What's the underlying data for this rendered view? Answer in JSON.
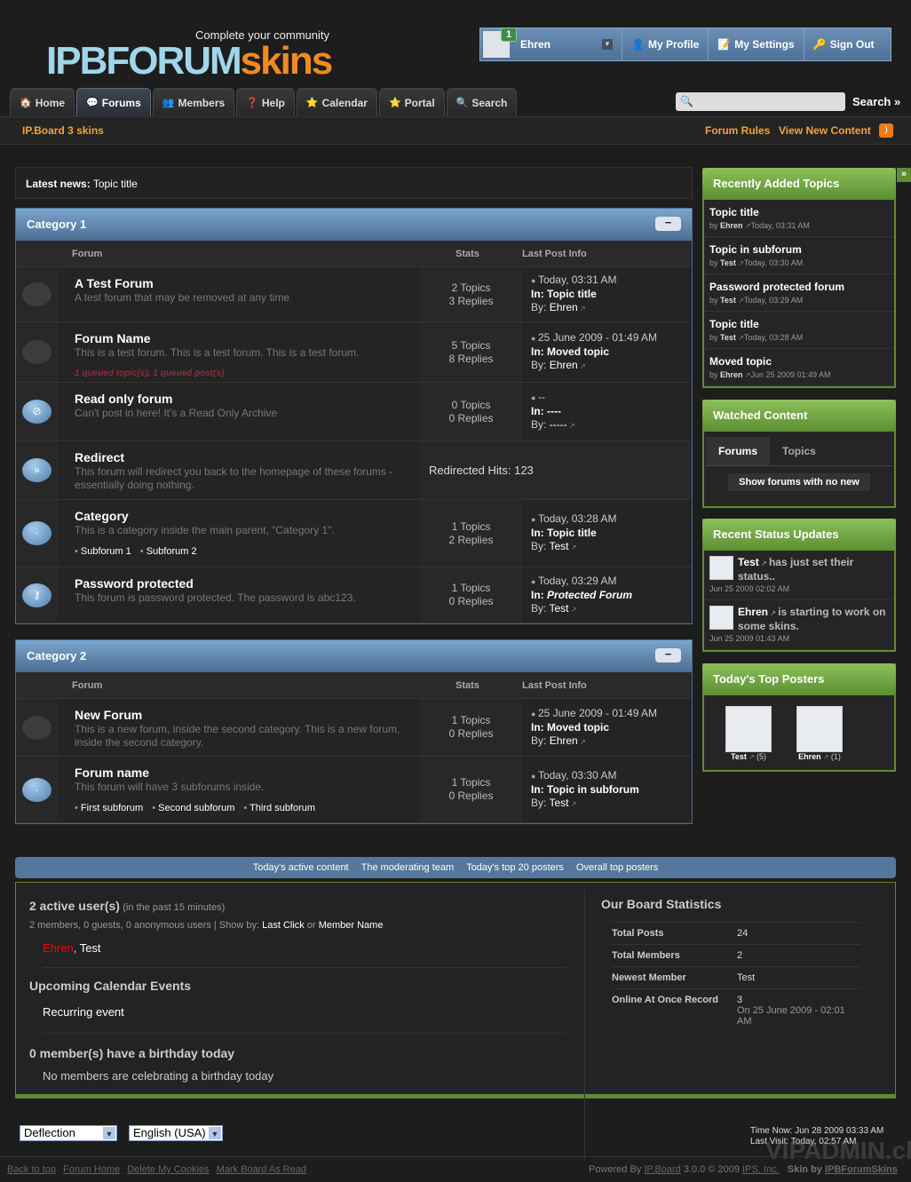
{
  "header": {
    "tagline": "Complete your community",
    "logo_a": "IPBFORUM",
    "logo_b": "SKINS",
    "user": {
      "name": "Ehren",
      "notifications": "1",
      "my_profile": "My Profile",
      "my_settings": "My Settings",
      "sign_out": "Sign Out"
    }
  },
  "nav": {
    "tabs": [
      "Home",
      "Forums",
      "Members",
      "Help",
      "Calendar",
      "Portal",
      "Search"
    ],
    "active": 1,
    "search_placeholder": "",
    "search_button": "Search »"
  },
  "subbar": {
    "board_name": "IP.Board 3 skins",
    "forum_rules": "Forum Rules",
    "view_new": "View New Content"
  },
  "news": {
    "label": "Latest news:",
    "value": "Topic title"
  },
  "columns": {
    "forum": "Forum",
    "stats": "Stats",
    "last": "Last Post Info"
  },
  "categories": [
    {
      "title": "Category 1",
      "collapse": "−",
      "forums": [
        {
          "icon": "no-new",
          "name": "A Test Forum",
          "desc": "A test forum that may be removed at any time",
          "topics": "2 Topics",
          "replies": "3 Replies",
          "date": "Today, 03:31 AM",
          "in_label": "In:",
          "in": "Topic title",
          "by_label": "By:",
          "by": "Ehren"
        },
        {
          "icon": "no-new",
          "name": "Forum Name",
          "desc": "This is a test forum. This is a test forum. This is a test forum.",
          "queued": "1 queued topic(s), 1 queued post(s)",
          "topics": "5 Topics",
          "replies": "8 Replies",
          "date": "25 June 2009 - 01:49 AM",
          "in_label": "In:",
          "in": "Moved topic",
          "by_label": "By:",
          "by": "Ehren"
        },
        {
          "icon": "read-only",
          "name": "Read only forum",
          "desc": "Can't post in here! It's a Read Only Archive",
          "topics": "0 Topics",
          "replies": "0 Replies",
          "date": "--",
          "in_label": "In:",
          "in": "----",
          "by_label": "By:",
          "by": "-----"
        },
        {
          "icon": "redirect",
          "name": "Redirect",
          "desc": "This forum will redirect you back to the homepage of these forums - essentially doing nothing.",
          "redirect": "Redirected Hits: 123"
        },
        {
          "icon": "category",
          "name": "Category",
          "desc": "This is a category inside the main parent, \"Category 1\".",
          "subforums": [
            "Subforum 1",
            "Subforum 2"
          ],
          "topics": "1 Topics",
          "replies": "2 Replies",
          "date": "Today, 03:28 AM",
          "in_label": "In:",
          "in": "Topic title",
          "by_label": "By:",
          "by": "Test"
        },
        {
          "icon": "password",
          "name": "Password protected",
          "desc": "This forum is password protected. The password is abc123.",
          "topics": "1 Topics",
          "replies": "0 Replies",
          "date": "Today, 03:29 AM",
          "in_label": "In:",
          "in": "Protected Forum",
          "in_italic": true,
          "by_label": "By:",
          "by": "Test"
        }
      ]
    },
    {
      "title": "Category 2",
      "collapse": "−",
      "forums": [
        {
          "icon": "no-new",
          "name": "New Forum",
          "desc": "This is a new forum, inside the second category. This is a new forum, inside the second category.",
          "topics": "1 Topics",
          "replies": "0 Replies",
          "date": "25 June 2009 - 01:49 AM",
          "in_label": "In:",
          "in": "Moved topic",
          "by_label": "By:",
          "by": "Ehren"
        },
        {
          "icon": "category",
          "name": "Forum name",
          "desc": "This forum will have 3 subforums inside.",
          "subforums": [
            "First subforum",
            "Second subforum",
            "Third subforum"
          ],
          "topics": "1 Topics",
          "replies": "0 Replies",
          "date": "Today, 03:30 AM",
          "in_label": "In:",
          "in": "Topic in subforum",
          "by_label": "By:",
          "by": "Test"
        }
      ]
    }
  ],
  "sidebar": {
    "recent_topics": {
      "title": "Recently Added Topics",
      "items": [
        {
          "title": "Topic title",
          "by": "by",
          "author": "Ehren",
          "date": "Today, 03:31 AM"
        },
        {
          "title": "Topic in subforum",
          "by": "by",
          "author": "Test",
          "date": "Today, 03:30 AM"
        },
        {
          "title": "Password protected forum",
          "by": "by",
          "author": "Test",
          "date": "Today, 03:29 AM"
        },
        {
          "title": "Topic title",
          "by": "by",
          "author": "Test",
          "date": "Today, 03:28 AM"
        },
        {
          "title": "Moved topic",
          "by": "by",
          "author": "Ehren",
          "date": "Jun 25 2009 01:49 AM"
        }
      ]
    },
    "watched": {
      "title": "Watched Content",
      "tabs": [
        "Forums",
        "Topics"
      ],
      "button": "Show forums with no new"
    },
    "status": {
      "title": "Recent Status Updates",
      "items": [
        {
          "name": "Test",
          "text": "has just set their status..",
          "date": "Jun 25 2009 02:02 AM"
        },
        {
          "name": "Ehren",
          "text": "is starting to work on some skins.",
          "date": "Jun 25 2009 01:43 AM"
        }
      ]
    },
    "top_posters": {
      "title": "Today's Top Posters",
      "items": [
        {
          "name": "Test",
          "count": "(5)"
        },
        {
          "name": "Ehren",
          "count": "(1)"
        }
      ]
    }
  },
  "statbar": [
    "Today's active content",
    "The moderating team",
    "Today's top 20 posters",
    "Overall top posters"
  ],
  "board": {
    "active_title": "2 active user(s)",
    "active_note": "(in the past 15 minutes)",
    "active_detail": "2 members, 0 guests, 0 anonymous users | Show by:",
    "last_click": "Last Click",
    "or": "or",
    "member_name": "Member Name",
    "users": [
      "Ehren",
      "Test"
    ],
    "calendar_title": "Upcoming Calendar Events",
    "calendar_event": "Recurring event",
    "birthday_title": "0 member(s) have a birthday today",
    "birthday_text": "No members are celebrating a birthday today",
    "stats_title": "Our Board Statistics",
    "stats": [
      {
        "k": "Total Posts",
        "v": "24"
      },
      {
        "k": "Total Members",
        "v": "2"
      },
      {
        "k": "Newest Member",
        "v": "Test"
      },
      {
        "k": "Online At Once Record",
        "v": "3",
        "sub": "On 25 June 2009 - 02:01 AM"
      }
    ]
  },
  "footer": {
    "skin": "Deflection",
    "language": "English (USA)",
    "time_now": "Time Now: Jun 28 2009 03:33 AM",
    "last_visit": "Last Visit: Today, 02:57 AM",
    "links": [
      "Back to top",
      "Forum Home",
      "Delete My Cookies",
      "Mark Board As Read"
    ],
    "powered": "Powered By",
    "ipb": "IP.Board",
    "version": "3.0.0 © 2009",
    "ips": "IPS, Inc.",
    "skin_by": "Skin by",
    "skin_author": "IPBForumSkins",
    "watermark": "VIPADMIN.club"
  },
  "colors": {
    "accent_orange": "#f3a33a",
    "category_blue": "#5b7fa6",
    "sidebar_green": "#6a9e3d"
  }
}
